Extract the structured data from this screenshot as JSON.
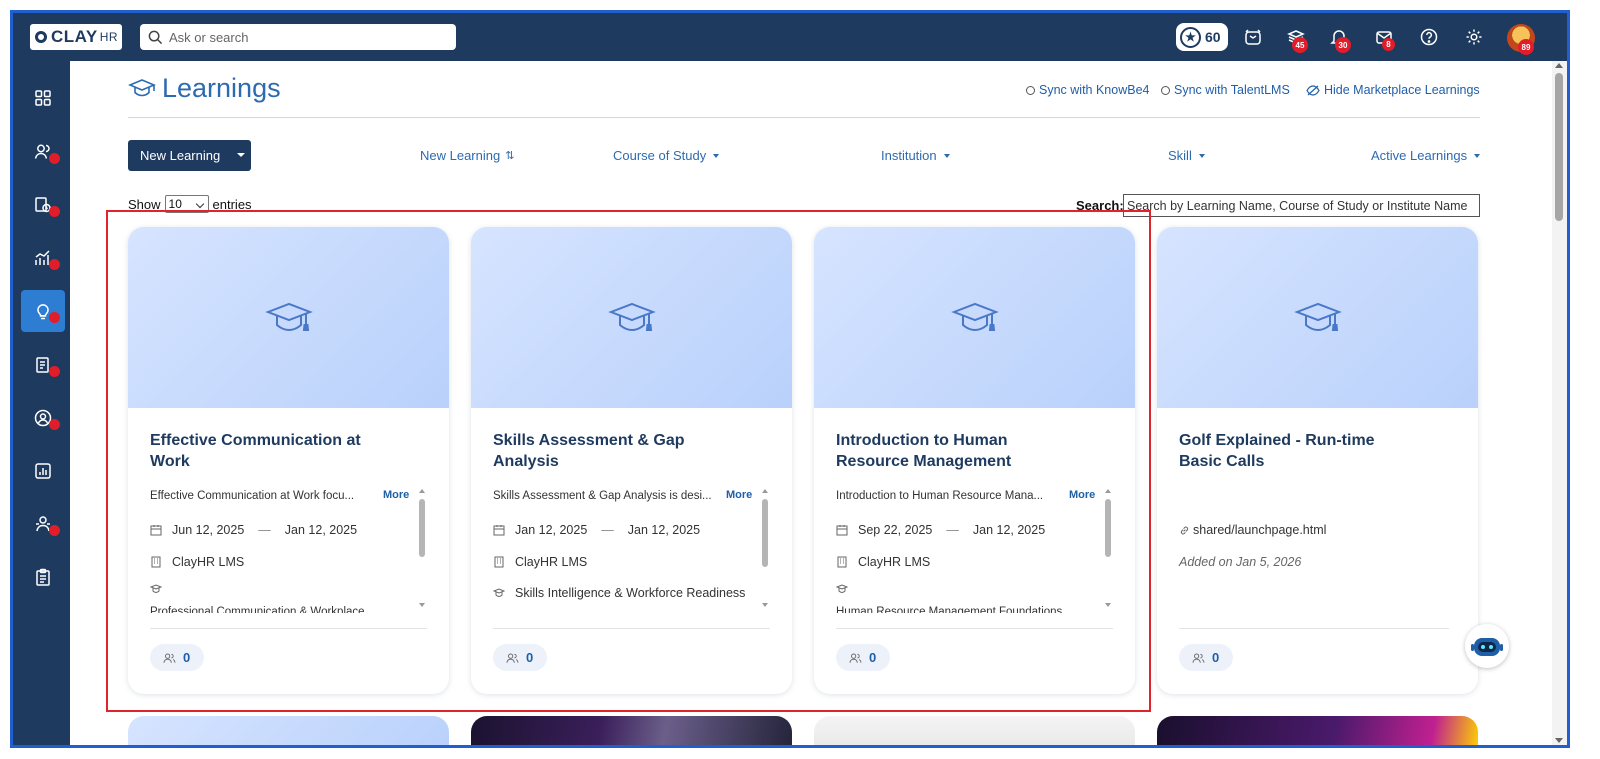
{
  "app": {
    "logo": "CLAY",
    "logo_suffix": "HR"
  },
  "topbar": {
    "search_placeholder": "Ask or search",
    "points": "60",
    "badges": {
      "learning": "45",
      "notifications": "30",
      "messages": "8",
      "avatar": "89"
    }
  },
  "page": {
    "title": "Learnings",
    "sync_knowbe4": "Sync with KnowBe4",
    "sync_talentlms": "Sync with TalentLMS",
    "hide_marketplace": "Hide Marketplace Learnings"
  },
  "toolbar": {
    "new_button": "New Learning",
    "filters": [
      "New Learning",
      "Course of Study",
      "Institution",
      "Skill",
      "Active Learnings"
    ],
    "sort_glyph": "⇅"
  },
  "table": {
    "show_label": "Show",
    "entries_value": "10",
    "entries_label": "entries",
    "search_label": "Search:",
    "search_placeholder": "Search by Learning Name, Course of Study or Institute Name"
  },
  "cards": [
    {
      "title": "Effective Communication at Work",
      "desc": "Effective Communication at Work focu...",
      "more": "More",
      "start": "Jun 12, 2025",
      "end": "Jan 12, 2025",
      "institution": "ClayHR LMS",
      "course": "",
      "cut": "Professional Communication & Workplace",
      "count": "0"
    },
    {
      "title": "Skills Assessment & Gap Analysis",
      "desc": "Skills Assessment & Gap Analysis is desi...",
      "more": "More",
      "start": "Jan 12, 2025",
      "end": "Jan 12, 2025",
      "institution": "ClayHR LMS",
      "course": "Skills Intelligence & Workforce Readiness",
      "cut": "",
      "count": "0"
    },
    {
      "title": "Introduction to Human Resource Management",
      "desc": "Introduction to Human Resource Mana...",
      "more": "More",
      "start": "Sep 22, 2025",
      "end": "Jan 12, 2025",
      "institution": "ClayHR LMS",
      "course": "",
      "cut": "Human Resource Management Foundations",
      "count": "0"
    },
    {
      "title": "Golf Explained - Run-time Basic Calls",
      "link": "shared/launchpage.html",
      "added": "Added on Jan 5, 2026",
      "count": "0"
    }
  ],
  "colors": {
    "navy": "#1e3a5f",
    "accent": "#2d7dd2",
    "badge": "#e11d2a",
    "highlight": "#e0242b"
  }
}
